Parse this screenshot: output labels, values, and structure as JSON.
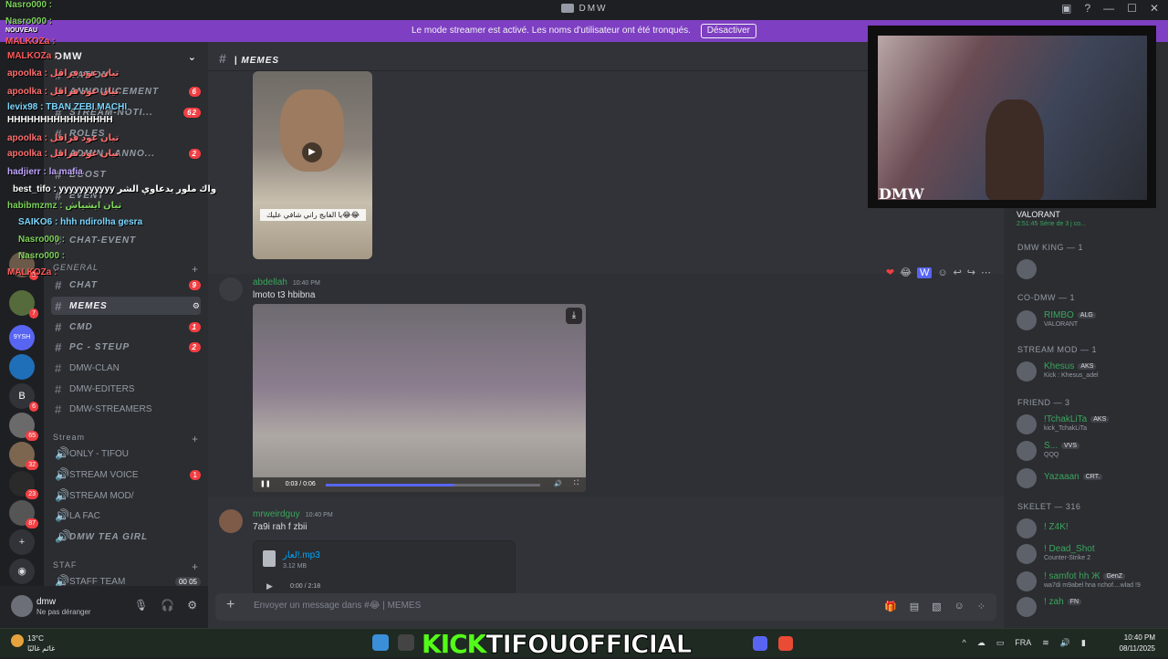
{
  "window": {
    "title": "DMW",
    "controls": [
      "—",
      "☐",
      "✕"
    ]
  },
  "banner": {
    "text": "Le mode streamer est activé. Les noms d'utilisateur ont été tronqués.",
    "button": "Désactiver"
  },
  "guilds": [
    {
      "label": "",
      "badge": "2"
    },
    {
      "label": "",
      "badge": "7"
    },
    {
      "label": "9YSH",
      "badge": ""
    },
    {
      "label": "",
      "badge": ""
    },
    {
      "label": "B",
      "badge": "6"
    },
    {
      "label": "",
      "badge": "65"
    },
    {
      "label": "",
      "badge": "32"
    },
    {
      "label": "",
      "badge": "23"
    },
    {
      "label": "",
      "badge": "87"
    }
  ],
  "server": {
    "name": "DMW"
  },
  "channels": [
    {
      "label": "CATION",
      "badge": ""
    },
    {
      "label": "ANNOUNCEMENT",
      "badge": "6"
    },
    {
      "label": "STREAM-NOTI...",
      "badge": "62"
    },
    {
      "label": "ROLES",
      "badge": ""
    },
    {
      "label": "ADMIN - ANNO...",
      "badge": "2"
    },
    {
      "label": "BOOST",
      "badge": ""
    },
    {
      "label": "EVENT",
      "badge": ""
    },
    {
      "label": "CHAT-EVENT",
      "badge": ""
    },
    {
      "label": "CHAT",
      "badge": "9"
    },
    {
      "label": "MEMES",
      "badge": ""
    },
    {
      "label": "CMD",
      "badge": "1"
    },
    {
      "label": "PC - STEUP",
      "badge": "2"
    },
    {
      "label": "DMW-CLAN",
      "badge": ""
    },
    {
      "label": "DMW-EDITERS",
      "badge": ""
    },
    {
      "label": "DMW-STREAMERS",
      "badge": ""
    },
    {
      "label": "ONLY - TIFOU",
      "badge": ""
    },
    {
      "label": "STREAM VOICE",
      "badge": "1"
    },
    {
      "label": "STREAM MOD/",
      "badge": ""
    },
    {
      "label": "LA FAC",
      "badge": ""
    },
    {
      "label": "DMW TEA GIRL",
      "badge": ""
    },
    {
      "label": "STAFF TEAM",
      "badge": "00 05"
    }
  ],
  "categories": {
    "general": "GENERAL",
    "stream": "Stream",
    "staf": "STAF"
  },
  "user": {
    "name": "dmw",
    "status": "Ne pas déranger"
  },
  "chat": {
    "channel": "| MEMES",
    "image_caption": "يا الفايج راني شافي عليك😂😂",
    "msg1": {
      "author": "abdellah",
      "time": "10:40 PM",
      "text": "lmoto t3 hbibna",
      "video_time": "0:03 / 0:06",
      "progress": 0.6
    },
    "msg2": {
      "author": "mrweirdguy",
      "time": "10:40 PM",
      "text": "7a9i rah f zbii",
      "file_name": "لعار!.mp3",
      "file_size": "3.12 MB",
      "file_time": "0:00 / 2:18"
    },
    "composer_placeholder": "Envoyer un message dans #😂 | MEMES"
  },
  "members": {
    "top": {
      "name": "VALORANT",
      "status": "2:51:45  Série de 3 j co..."
    },
    "groups": [
      {
        "title": "DMW KING — 1"
      },
      {
        "title": "CO-DMW — 1"
      },
      {
        "title": "STREAM MOD — 1"
      },
      {
        "title": "FRIEND — 3"
      },
      {
        "title": "SKELET — 316"
      }
    ],
    "list": [
      {
        "name": "",
        "status": ""
      },
      {
        "name": "RIMBO",
        "tag": "ALG",
        "status": "VALORANT"
      },
      {
        "name": "Khesus",
        "tag": "AKS",
        "status": "Kick : Khesus_adel"
      },
      {
        "name": "!TchakLiTa",
        "tag": "AKS",
        "status": "kick_TchakLiTa"
      },
      {
        "name": "S...",
        "tag": "VVS",
        "status": "QQQ"
      },
      {
        "name": "Yazaaan",
        "tag": "CRT.",
        "status": ""
      },
      {
        "name": "! Z4K!",
        "tag": "",
        "status": ""
      },
      {
        "name": "! Dead_Shot",
        "tag": "",
        "status": "Counter-Strike 2"
      },
      {
        "name": "! samfot hh Ж",
        "tag": "GenZ",
        "status": "wa7di m9abel hna nchof....wlad !9"
      },
      {
        "name": "! zah",
        "tag": "FN",
        "status": ""
      }
    ]
  },
  "webcam": {
    "watermark": "DMW"
  },
  "overlay": [
    {
      "text": "Nasro000 :",
      "color": "#7dd35a"
    },
    {
      "text": "Nasro000 :",
      "color": "#7dd35a"
    },
    {
      "text": "NOUVEAU",
      "color": "#ffffff"
    },
    {
      "text": "MALKOZa :",
      "color": "#ff5b5b"
    },
    {
      "text": "MALKOZa :",
      "color": "#ff5b5b"
    },
    {
      "text": "apoolka : تيان عود فراقل",
      "color": "#ff6f6f"
    },
    {
      "text": "apoolka : تيان عود فراقل",
      "color": "#ff6f6f"
    },
    {
      "text": "levix98 : TBAN ZEBI MACHI",
      "color": "#7ad7ff"
    },
    {
      "text": "HHHHHHHHHHHHHHHH",
      "color": "#ffffff"
    },
    {
      "text": "apoolka : تيان عود فراقل",
      "color": "#ff6f6f"
    },
    {
      "text": "apoolka : تيان عود فراقل",
      "color": "#ff6f6f"
    },
    {
      "text": "hadjierr : la mafia",
      "color": "#c3a6ff"
    },
    {
      "text": "best_tifo : yyyyyyyyyyy واك ملور يدعاوي الشر",
      "color": "#ffffff"
    },
    {
      "text": "habibmzmz : تيان ايشياش",
      "color": "#7dd35a"
    },
    {
      "text": "SAIKO6 : hhh ndirolha gesra",
      "color": "#7ad7ff"
    },
    {
      "text": "Nasro000 :",
      "color": "#7dd35a"
    },
    {
      "text": "Nasro000 :",
      "color": "#7dd35a"
    },
    {
      "text": "MALKOZa :",
      "color": "#ff5b5b"
    }
  ],
  "taskbar": {
    "weather_temp": "13°C",
    "weather_desc": "غائم غالبًا",
    "kick_prefix": "KICK",
    "kick_name": "TIFOUOFFICIAL",
    "lang": "FRA",
    "time": "10:40 PM",
    "date": "08/11/2025"
  }
}
